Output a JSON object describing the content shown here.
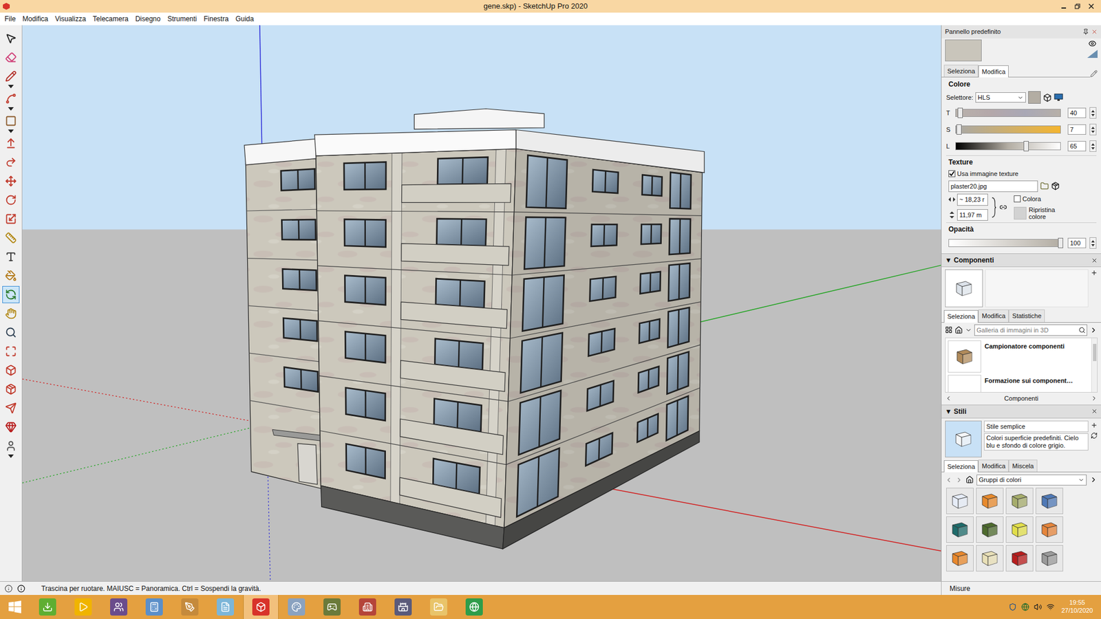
{
  "window": {
    "title": "gene.skp) - SketchUp Pro 2020"
  },
  "menu": [
    "File",
    "Modifica",
    "Visualizza",
    "Telecamera",
    "Disegno",
    "Strumenti",
    "Finestra",
    "Guida"
  ],
  "toolbar": [
    {
      "kind": "select",
      "selected": false,
      "dropdown": false
    },
    {
      "kind": "eraser",
      "selected": false,
      "dropdown": false
    },
    {
      "kind": "line",
      "selected": false,
      "dropdown": true
    },
    {
      "kind": "arc",
      "selected": false,
      "dropdown": true
    },
    {
      "kind": "rectangle",
      "selected": false,
      "dropdown": true
    },
    {
      "kind": "pushpull",
      "selected": false,
      "dropdown": false
    },
    {
      "kind": "followme",
      "selected": false,
      "dropdown": false
    },
    {
      "kind": "move",
      "selected": false,
      "dropdown": false
    },
    {
      "kind": "rotate",
      "selected": false,
      "dropdown": false
    },
    {
      "kind": "scale",
      "selected": false,
      "dropdown": false
    },
    {
      "kind": "tape",
      "selected": false,
      "dropdown": false
    },
    {
      "kind": "text",
      "selected": false,
      "dropdown": false
    },
    {
      "kind": "paint",
      "selected": false,
      "dropdown": false
    },
    {
      "kind": "orbit",
      "selected": true,
      "dropdown": false
    },
    {
      "kind": "pan",
      "selected": false,
      "dropdown": false
    },
    {
      "kind": "zoom",
      "selected": false,
      "dropdown": false
    },
    {
      "kind": "extents",
      "selected": false,
      "dropdown": false
    },
    {
      "kind": "warehouse",
      "selected": false,
      "dropdown": false
    },
    {
      "kind": "extensions",
      "selected": false,
      "dropdown": false
    },
    {
      "kind": "send",
      "selected": false,
      "dropdown": false
    },
    {
      "kind": "ruby",
      "selected": false,
      "dropdown": false
    },
    {
      "kind": "account",
      "selected": false,
      "dropdown": true
    }
  ],
  "panel": {
    "title": "Pannello predefinito",
    "materials": {
      "preview_color": "#c9c5bb",
      "tabs": [
        {
          "label": "Seleziona",
          "selected": false
        },
        {
          "label": "Modifica",
          "selected": true
        }
      ],
      "color_heading": "Colore",
      "picker_label": "Selettore:",
      "picker_value": "HLS",
      "swatch": "#b3ada3",
      "sliders": [
        {
          "label": "T",
          "value": "40",
          "level": 0.04,
          "kind": "hue"
        },
        {
          "label": "S",
          "value": "7",
          "level": 0.03,
          "kind": "saturation"
        },
        {
          "label": "L",
          "value": "65",
          "level": 0.67,
          "kind": "lightness"
        }
      ],
      "texture_heading": "Texture",
      "use_texture": {
        "label": "Usa immagine texture",
        "checked": true
      },
      "texture_file": "plaster20.jpg",
      "width": "~ 18,23 r",
      "height": "11,97 m",
      "colorize": {
        "label": "Colora",
        "checked": false
      },
      "reset_label": "Ripristina colore",
      "opacity_heading": "Opacità",
      "opacity": {
        "value": "100",
        "level": 1
      }
    },
    "components": {
      "arrow": "▼",
      "title": "Componenti",
      "tabs": [
        {
          "label": "Seleziona",
          "selected": true
        },
        {
          "label": "Modifica",
          "selected": false
        },
        {
          "label": "Statistiche",
          "selected": false
        }
      ],
      "search_placeholder": "Galleria di immagini in 3D",
      "items": [
        {
          "title": "Campionatore componenti"
        },
        {
          "title": "Formazione sui component…"
        }
      ],
      "footer": "Componenti"
    },
    "styles": {
      "arrow": "▼",
      "title": "Stili",
      "name": "Stile semplice",
      "description": "Colori superficie predefiniti. Cielo blu e sfondo di colore grigio.",
      "tabs": [
        {
          "label": "Seleziona",
          "selected": true
        },
        {
          "label": "Modifica",
          "selected": false
        },
        {
          "label": "Miscela",
          "selected": false
        }
      ],
      "collection": "Gruppi di colori",
      "swatches": [
        {
          "color": "#e6ecf7"
        },
        {
          "color": "#e88a2c"
        },
        {
          "color": "#a6ad6c"
        },
        {
          "color": "#4f79b6"
        },
        {
          "color": "#1e6b6a"
        },
        {
          "color": "#4d6a2d"
        },
        {
          "color": "#e2df4a"
        },
        {
          "color": "#e6853b"
        },
        {
          "color": "#e9882c"
        },
        {
          "color": "#e8dfb6"
        },
        {
          "color": "#b81d1d"
        },
        {
          "color": "#9b9b9b"
        }
      ]
    }
  },
  "status_bar": {
    "hint": "Trascina per ruotare. MAIUSC = Panoramica. Ctrl = Sospendi la gravità.",
    "measurements_label": "Misure"
  },
  "taskbar": {
    "apps": [
      {
        "kind": "utorrent",
        "color": "#5fae32",
        "active": false
      },
      {
        "kind": "player",
        "color": "#f0b400",
        "active": false
      },
      {
        "kind": "game",
        "color": "#6a4c8c",
        "active": false
      },
      {
        "kind": "calculator",
        "color": "#5b8fc9",
        "active": false
      },
      {
        "kind": "paint",
        "color": "#c58a3c",
        "active": false
      },
      {
        "kind": "editor",
        "color": "#7cb6d8",
        "active": false
      },
      {
        "kind": "sketchup",
        "color": "#d8322a",
        "active": true
      },
      {
        "kind": "palette",
        "color": "#8aa2c0",
        "active": false
      },
      {
        "kind": "strategy",
        "color": "#6b7a3a",
        "active": false
      },
      {
        "kind": "house",
        "color": "#b5453a",
        "active": false
      },
      {
        "kind": "castle",
        "color": "#5a5a7a",
        "active": false
      },
      {
        "kind": "explorer",
        "color": "#e9c46a",
        "active": false
      },
      {
        "kind": "browser",
        "color": "#2f9d4a",
        "active": false
      }
    ],
    "time": "19:55",
    "date": "27/10/2020"
  }
}
